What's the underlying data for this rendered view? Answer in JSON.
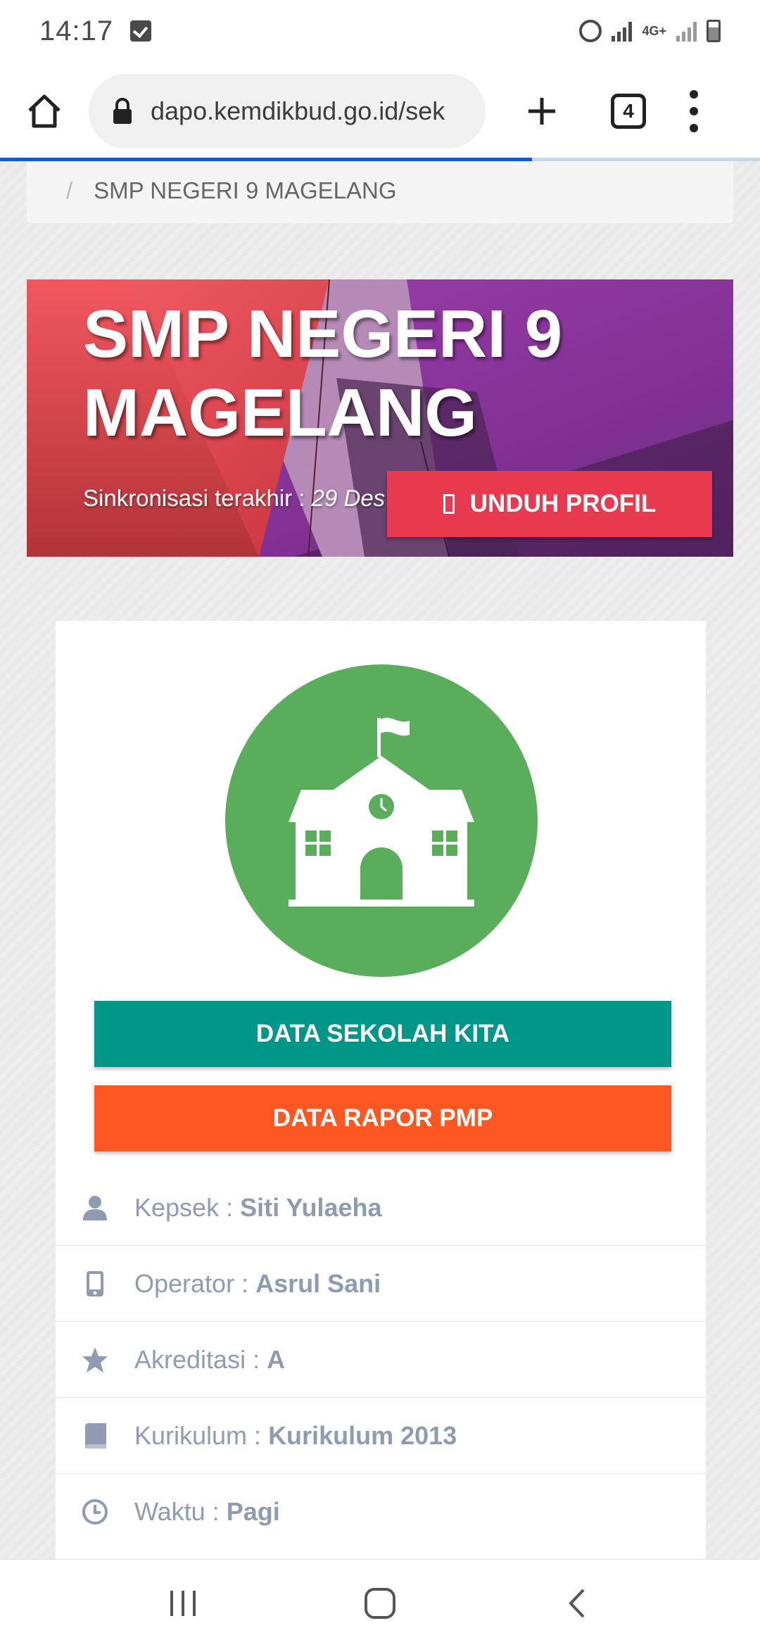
{
  "status_bar": {
    "time": "14:17",
    "network_label": "4G+",
    "icons": [
      "checkbox-notification-icon",
      "alarm-icon",
      "signal-icon",
      "battery-icon"
    ]
  },
  "browser": {
    "url": "dapo.kemdikbud.go.id/sek",
    "tab_count": "4",
    "load_progress": 0.7,
    "icons": [
      "home-icon",
      "lock-icon",
      "plus-icon",
      "tabs-icon",
      "menu-icon"
    ]
  },
  "breadcrumb": {
    "separator": "/",
    "current": "SMP NEGERI 9 MAGELANG"
  },
  "hero": {
    "title": "SMP NEGERI 9 MAGELANG",
    "sync_label": "Sinkronisasi terakhir : ",
    "sync_date": "29 Des",
    "download_button": "UNDUH PROFIL"
  },
  "school_card": {
    "icon": "school-building-icon",
    "buttons": {
      "data_sekolah": "DATA SEKOLAH KITA",
      "data_rapor": "DATA RAPOR PMP"
    },
    "info": [
      {
        "label": "Kepsek : ",
        "value": "Siti Yulaeha",
        "icon": "user-icon"
      },
      {
        "label": "Operator : ",
        "value": "Asrul Sani",
        "icon": "mobile-icon"
      },
      {
        "label": "Akreditasi : ",
        "value": "A",
        "icon": "star-icon"
      },
      {
        "label": "Kurikulum : ",
        "value": "Kurikulum 2013",
        "icon": "book-icon"
      },
      {
        "label": "Waktu : ",
        "value": "Pagi",
        "icon": "clock-icon"
      }
    ]
  },
  "colors": {
    "green": "#5aae5b",
    "teal": "#009688",
    "orange": "#ff5722",
    "red_button": "#e83a4f",
    "info_text": "#8f9bb3"
  },
  "nav_bar": {
    "icons": [
      "recent-apps-icon",
      "home-nav-icon",
      "back-icon"
    ]
  }
}
